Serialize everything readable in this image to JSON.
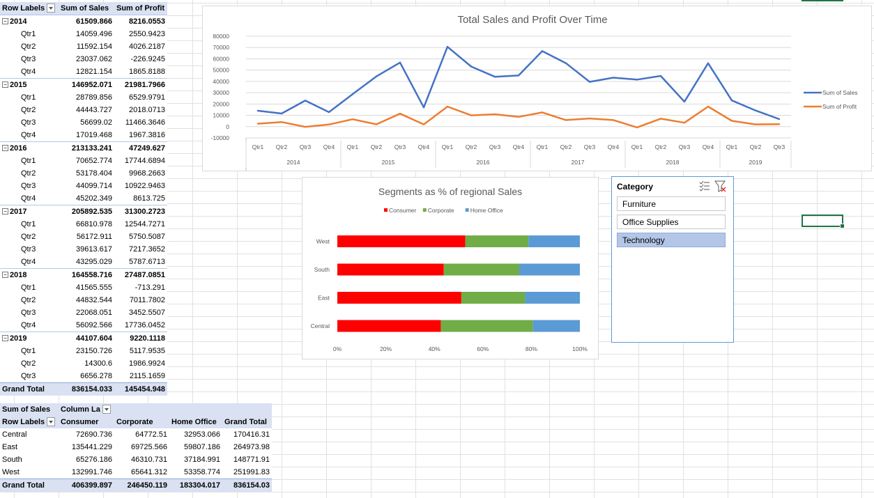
{
  "pivot_time": {
    "headers": {
      "row_labels": "Row Labels",
      "sales": "Sum of Sales",
      "profit": "Sum of Profit"
    },
    "years": [
      {
        "year": "2014",
        "sales": "61509.866",
        "profit": "8216.0553",
        "quarters": [
          {
            "label": "Qtr1",
            "sales": "14059.496",
            "profit": "2550.9423"
          },
          {
            "label": "Qtr2",
            "sales": "11592.154",
            "profit": "4026.2187"
          },
          {
            "label": "Qtr3",
            "sales": "23037.062",
            "profit": "-226.9245"
          },
          {
            "label": "Qtr4",
            "sales": "12821.154",
            "profit": "1865.8188"
          }
        ]
      },
      {
        "year": "2015",
        "sales": "146952.071",
        "profit": "21981.7966",
        "quarters": [
          {
            "label": "Qtr1",
            "sales": "28789.856",
            "profit": "6529.9791"
          },
          {
            "label": "Qtr2",
            "sales": "44443.727",
            "profit": "2018.0713"
          },
          {
            "label": "Qtr3",
            "sales": "56699.02",
            "profit": "11466.3646"
          },
          {
            "label": "Qtr4",
            "sales": "17019.468",
            "profit": "1967.3816"
          }
        ]
      },
      {
        "year": "2016",
        "sales": "213133.241",
        "profit": "47249.627",
        "quarters": [
          {
            "label": "Qtr1",
            "sales": "70652.774",
            "profit": "17744.6894"
          },
          {
            "label": "Qtr2",
            "sales": "53178.404",
            "profit": "9968.2663"
          },
          {
            "label": "Qtr3",
            "sales": "44099.714",
            "profit": "10922.9463"
          },
          {
            "label": "Qtr4",
            "sales": "45202.349",
            "profit": "8613.725"
          }
        ]
      },
      {
        "year": "2017",
        "sales": "205892.535",
        "profit": "31300.2723",
        "quarters": [
          {
            "label": "Qtr1",
            "sales": "66810.978",
            "profit": "12544.7271"
          },
          {
            "label": "Qtr2",
            "sales": "56172.911",
            "profit": "5750.5087"
          },
          {
            "label": "Qtr3",
            "sales": "39613.617",
            "profit": "7217.3652"
          },
          {
            "label": "Qtr4",
            "sales": "43295.029",
            "profit": "5787.6713"
          }
        ]
      },
      {
        "year": "2018",
        "sales": "164558.716",
        "profit": "27487.0851",
        "quarters": [
          {
            "label": "Qtr1",
            "sales": "41565.555",
            "profit": "-713.291"
          },
          {
            "label": "Qtr2",
            "sales": "44832.544",
            "profit": "7011.7802"
          },
          {
            "label": "Qtr3",
            "sales": "22068.051",
            "profit": "3452.5507"
          },
          {
            "label": "Qtr4",
            "sales": "56092.566",
            "profit": "17736.0452"
          }
        ]
      },
      {
        "year": "2019",
        "sales": "44107.604",
        "profit": "9220.1118",
        "quarters": [
          {
            "label": "Qtr1",
            "sales": "23150.726",
            "profit": "5117.9535"
          },
          {
            "label": "Qtr2",
            "sales": "14300.6",
            "profit": "1986.9924"
          },
          {
            "label": "Qtr3",
            "sales": "6656.278",
            "profit": "2115.1659"
          }
        ]
      }
    ],
    "grand_total": {
      "label": "Grand Total",
      "sales": "836154.033",
      "profit": "145454.948"
    }
  },
  "pivot_segment": {
    "corner": "Sum of Sales",
    "col_labels": "Column La",
    "row_labels": "Row Labels",
    "columns": [
      "Consumer",
      "Corporate",
      "Home Office",
      "Grand Total"
    ],
    "rows": [
      {
        "label": "Central",
        "values": [
          "72690.736",
          "64772.51",
          "32953.066",
          "170416.31"
        ]
      },
      {
        "label": "East",
        "values": [
          "135441.229",
          "69725.566",
          "59807.186",
          "264973.98"
        ]
      },
      {
        "label": "South",
        "values": [
          "65276.186",
          "46310.731",
          "37184.991",
          "148771.91"
        ]
      },
      {
        "label": "West",
        "values": [
          "132991.746",
          "65641.312",
          "53358.774",
          "251991.83"
        ]
      }
    ],
    "grand_total": {
      "label": "Grand Total",
      "values": [
        "406399.897",
        "246450.119",
        "183304.017",
        "836154.03"
      ]
    }
  },
  "slicer": {
    "title": "Category",
    "items": [
      {
        "label": "Furniture",
        "selected": false
      },
      {
        "label": "Office Supplies",
        "selected": false
      },
      {
        "label": "Technology",
        "selected": true
      }
    ],
    "icons": [
      "multi-select-icon",
      "clear-filter-icon"
    ]
  },
  "chart_data": [
    {
      "type": "line",
      "title": "Total Sales and Profit Over Time",
      "categories": [
        "Qtr1",
        "Qtr2",
        "Qtr3",
        "Qtr4",
        "Qtr1",
        "Qtr2",
        "Qtr3",
        "Qtr4",
        "Qtr1",
        "Qtr2",
        "Qtr3",
        "Qtr4",
        "Qtr1",
        "Qtr2",
        "Qtr3",
        "Qtr4",
        "Qtr1",
        "Qtr2",
        "Qtr3",
        "Qtr4",
        "Qtr1",
        "Qtr2",
        "Qtr3"
      ],
      "groups": [
        {
          "label": "2014",
          "count": 4
        },
        {
          "label": "2015",
          "count": 4
        },
        {
          "label": "2016",
          "count": 4
        },
        {
          "label": "2017",
          "count": 4
        },
        {
          "label": "2018",
          "count": 4
        },
        {
          "label": "2019",
          "count": 3
        }
      ],
      "yticks": [
        "80000",
        "70000",
        "60000",
        "50000",
        "40000",
        "30000",
        "20000",
        "10000",
        "0",
        "-10000"
      ],
      "ylim": [
        -10000,
        80000
      ],
      "series": [
        {
          "name": "Sum of Sales",
          "color": "#4472c4",
          "values": [
            14059.496,
            11592.154,
            23037.062,
            12821.154,
            28789.856,
            44443.727,
            56699.02,
            17019.468,
            70652.774,
            53178.404,
            44099.714,
            45202.349,
            66810.978,
            56172.911,
            39613.617,
            43295.029,
            41565.555,
            44832.544,
            22068.051,
            56092.566,
            23150.726,
            14300.6,
            6656.278
          ]
        },
        {
          "name": "Sum of Profit",
          "color": "#ed7d31",
          "values": [
            2550.9423,
            4026.2187,
            -226.9245,
            1865.8188,
            6529.9791,
            2018.0713,
            11466.3646,
            1967.3816,
            17744.6894,
            9968.2663,
            10922.9463,
            8613.725,
            12544.7271,
            5750.5087,
            7217.3652,
            5787.6713,
            -713.291,
            7011.7802,
            3452.5507,
            17736.0452,
            5117.9535,
            1986.9924,
            2115.1659
          ]
        }
      ],
      "legend": "right",
      "grid": true
    },
    {
      "type": "bar",
      "orientation": "horizontal",
      "stacked": "percent",
      "title": "Segments as % of regional Sales",
      "categories": [
        "West",
        "South",
        "East",
        "Central"
      ],
      "series": [
        {
          "name": "Consumer",
          "color": "#ff0000",
          "values": [
            132991.746,
            65276.186,
            135441.229,
            72690.736
          ]
        },
        {
          "name": "Corporate",
          "color": "#70ad47",
          "values": [
            65641.312,
            46310.731,
            69725.566,
            64772.51
          ]
        },
        {
          "name": "Home Office",
          "color": "#5b9bd5",
          "values": [
            53358.774,
            37184.991,
            59807.186,
            32953.066
          ]
        }
      ],
      "xticks": [
        "0%",
        "20%",
        "40%",
        "60%",
        "80%",
        "100%"
      ],
      "xlim": [
        0,
        100
      ],
      "legend": "top",
      "grid": false
    }
  ]
}
